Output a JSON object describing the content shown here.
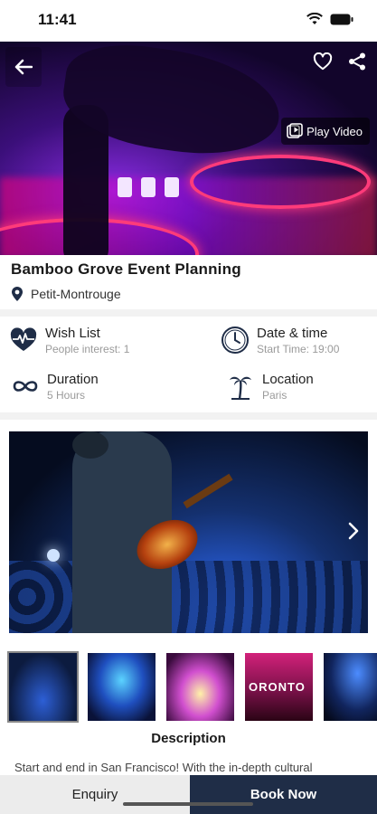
{
  "status_bar": {
    "time": "11:41"
  },
  "hero": {
    "play_video_label": "Play Video",
    "icons": {
      "back": "back-arrow-icon",
      "favorite": "heart-outline-icon",
      "share": "share-icon",
      "play": "play-video-icon"
    }
  },
  "event": {
    "title": "Bamboo Grove Event Planning",
    "location": "Petit-Montrouge"
  },
  "info": {
    "wish_list": {
      "label": "Wish List",
      "sub": "People interest: 1",
      "icon": "heartbeat-icon"
    },
    "date_time": {
      "label": "Date & time",
      "sub": "Start Time: 19:00",
      "icon": "clock-icon"
    },
    "duration": {
      "label": "Duration",
      "sub": "5 Hours",
      "icon": "infinity-icon"
    },
    "location": {
      "label": "Location",
      "sub": "Paris",
      "icon": "palm-tree-icon"
    }
  },
  "gallery": {
    "thumbnail_text_4": "ORONTO"
  },
  "description": {
    "heading": "Description",
    "text": "Start and end in San Francisco! With the in-depth cultural"
  },
  "bottom_bar": {
    "enquiry_label": "Enquiry",
    "book_label": "Book Now"
  },
  "colors": {
    "primary_dark": "#1f2d47",
    "secondary": "#ececec",
    "hint_text": "#9a9a9a"
  }
}
